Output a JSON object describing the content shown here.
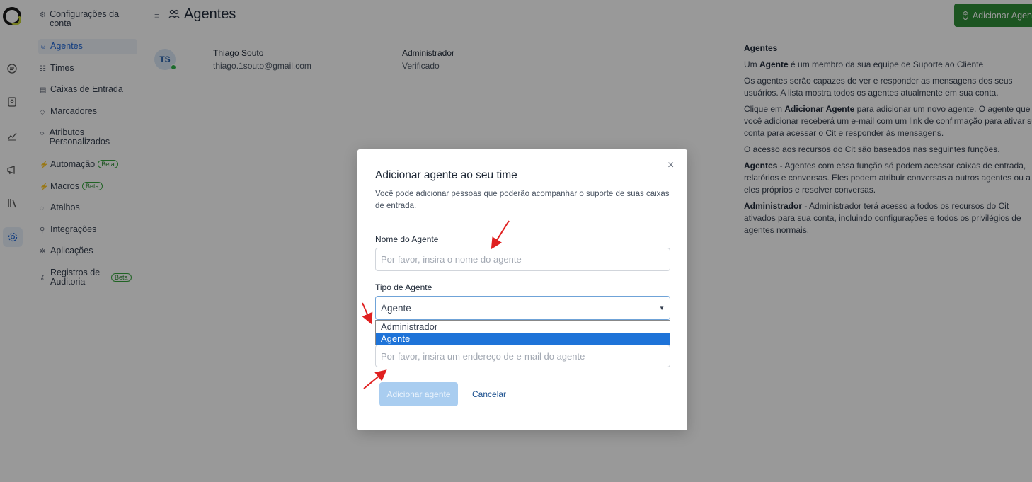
{
  "sidebar": {
    "items": [
      {
        "label": "Configurações da conta",
        "icon": "user-icon"
      },
      {
        "label": "Agentes",
        "icon": "people-icon"
      },
      {
        "label": "Times",
        "icon": "team-icon"
      },
      {
        "label": "Caixas de Entrada",
        "icon": "inbox-icon"
      },
      {
        "label": "Marcadores",
        "icon": "tag-icon"
      },
      {
        "label": "Atributos Personalizados",
        "icon": "code-icon"
      },
      {
        "label": "Automação",
        "icon": "automation-icon",
        "badge": "Beta"
      },
      {
        "label": "Macros",
        "icon": "macros-icon",
        "badge": "Beta"
      },
      {
        "label": "Atalhos",
        "icon": "shortcut-icon"
      },
      {
        "label": "Integrações",
        "icon": "plug-icon"
      },
      {
        "label": "Aplicações",
        "icon": "apps-icon"
      },
      {
        "label": "Registros de Auditoria",
        "icon": "key-icon",
        "badge": "Beta"
      }
    ]
  },
  "header": {
    "title": "Agentes",
    "add_button": "Adicionar Agente"
  },
  "agent": {
    "initials": "TS",
    "name": "Thiago Souto",
    "email": "thiago.1souto@gmail.com",
    "role": "Administrador",
    "status": "Verificado"
  },
  "help": {
    "heading": "Agentes",
    "p1_a": "Um ",
    "p1_b": "Agente",
    "p1_c": " é um membro da sua equipe de Suporte ao Cliente",
    "p2": "Os agentes serão capazes de ver e responder as mensagens dos seus usuários. A lista mostra todos os agentes atualmente em sua conta.",
    "p3_a": "Clique em ",
    "p3_b": "Adicionar Agente",
    "p3_c": " para adicionar um novo agente. O agente que você adicionar receberá um e-mail com um link de confirmação para ativar sua conta para acessar o Cit e responder às mensagens.",
    "p4": "O acesso aos recursos do Cit são baseados nas seguintes funções.",
    "p5_a": "Agentes",
    "p5_b": " - Agentes com essa função só podem acessar caixas de entrada, relatórios e conversas. Eles podem atribuir conversas a outros agentes ou a eles próprios e resolver conversas.",
    "p6_a": "Administrador",
    "p6_b": " - Administrador terá acesso a todos os recursos do Cit ativados para sua conta, incluindo configurações e todos os privilégios de agentes normais."
  },
  "modal": {
    "title": "Adicionar agente ao seu time",
    "description": "Você pode adicionar pessoas que poderão acompanhar o suporte de suas caixas de entrada.",
    "name_label": "Nome do Agente",
    "name_placeholder": "Por favor, insira o nome do agente",
    "type_label": "Tipo de Agente",
    "type_value": "Agente",
    "type_options": [
      "Administrador",
      "Agente"
    ],
    "email_placeholder": "Por favor, insira um endereço de e-mail do agente",
    "submit": "Adicionar agente",
    "cancel": "Cancelar",
    "close_glyph": "×"
  },
  "colors": {
    "accent": "#1f66d6",
    "primary_button": "#2f8e37",
    "annotation_arrow": "#e02020",
    "selected_option": "#1e73d8"
  }
}
